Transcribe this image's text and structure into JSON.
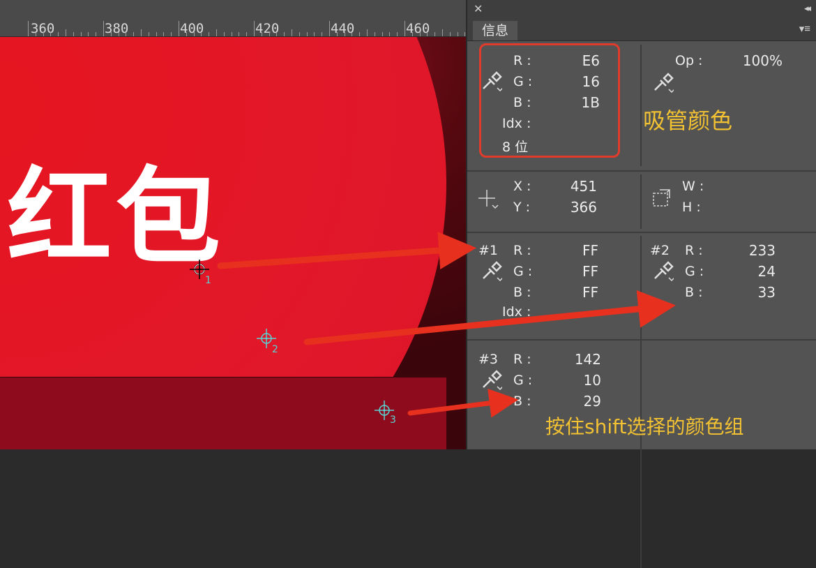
{
  "ruler": {
    "labels": [
      "360",
      "380",
      "400",
      "420",
      "440",
      "460"
    ]
  },
  "canvas": {
    "text": "红包",
    "sampler_numbers": [
      "1",
      "2",
      "3"
    ]
  },
  "panel": {
    "close_glyph": "✕",
    "collapse_glyph": "◂◂",
    "tab_label": "信息",
    "menu_glyph": "▾≡",
    "eyedropper": {
      "labels": [
        "R :",
        "G :",
        "B :",
        "Idx :",
        "8 位"
      ],
      "values": [
        "E6",
        "16",
        "1B"
      ]
    },
    "opacity": {
      "label": "Op :",
      "value": "100%"
    },
    "position": {
      "x_label": "X :",
      "x_value": "451",
      "y_label": "Y :",
      "y_value": "366"
    },
    "size": {
      "w_label": "W :",
      "h_label": "H :"
    },
    "sample1": {
      "id": "#1",
      "labels": [
        "R :",
        "G :",
        "B :",
        "Idx :"
      ],
      "values": [
        "FF",
        "FF",
        "FF"
      ]
    },
    "sample2": {
      "id": "#2",
      "labels": [
        "R :",
        "G :",
        "B :"
      ],
      "values": [
        "233",
        "24",
        "33"
      ]
    },
    "sample3": {
      "id": "#3",
      "labels": [
        "R :",
        "G :",
        "B :"
      ],
      "values": [
        "142",
        "10",
        "29"
      ]
    }
  },
  "annotations": {
    "eyedropper_color": "吸管颜色",
    "shift_group": "按住shift选择的颜色组"
  },
  "colors": {
    "arrow": "#e8301f",
    "annotation_text": "#f2c232",
    "highlight_box": "#e33b2b"
  }
}
